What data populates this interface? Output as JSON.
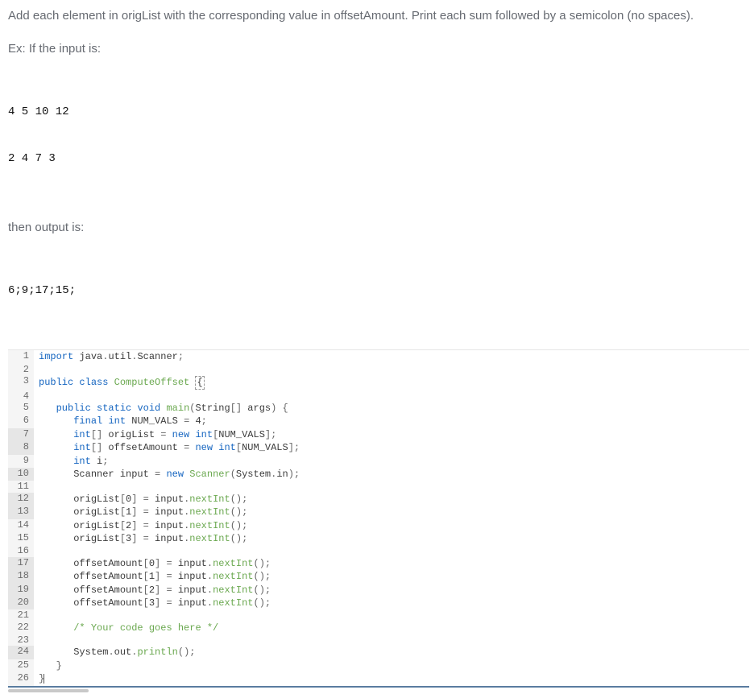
{
  "prompt": {
    "instruction": "Add each element in origList with the corresponding value in offsetAmount. Print each sum followed by a semicolon (no spaces).",
    "ex_label": "Ex: If the input is:",
    "input_lines": [
      "4 5 10 12",
      "2 4 7 3"
    ],
    "then_label": "then output is:",
    "output_line": "6;9;17;15;"
  },
  "code": {
    "lines": [
      {
        "n": 1,
        "indent": 0,
        "tokens": [
          [
            "kw",
            "import"
          ],
          [
            "pl",
            " java"
          ],
          [
            "op",
            "."
          ],
          [
            "pl",
            "util"
          ],
          [
            "op",
            "."
          ],
          [
            "pl",
            "Scanner"
          ],
          [
            "op",
            ";"
          ]
        ]
      },
      {
        "n": 2,
        "indent": 0,
        "tokens": []
      },
      {
        "n": 3,
        "indent": 0,
        "tokens": [
          [
            "kw",
            "public"
          ],
          [
            "pl",
            " "
          ],
          [
            "kw",
            "class"
          ],
          [
            "pl",
            " "
          ],
          [
            "mth",
            "ComputeOffset"
          ],
          [
            "pl",
            " "
          ],
          [
            "bracebox",
            "{"
          ]
        ]
      },
      {
        "n": 4,
        "indent": 0,
        "tokens": []
      },
      {
        "n": 5,
        "indent": 3,
        "tokens": [
          [
            "kw",
            "public"
          ],
          [
            "pl",
            " "
          ],
          [
            "kw",
            "static"
          ],
          [
            "pl",
            " "
          ],
          [
            "kw",
            "void"
          ],
          [
            "pl",
            " "
          ],
          [
            "mth",
            "main"
          ],
          [
            "op",
            "("
          ],
          [
            "pl",
            "String"
          ],
          [
            "op",
            "[]"
          ],
          [
            "pl",
            " args"
          ],
          [
            "op",
            ")"
          ],
          [
            "pl",
            " "
          ],
          [
            "op",
            "{"
          ]
        ]
      },
      {
        "n": 6,
        "indent": 6,
        "tokens": [
          [
            "kw",
            "final"
          ],
          [
            "pl",
            " "
          ],
          [
            "kw",
            "int"
          ],
          [
            "pl",
            " NUM_VALS "
          ],
          [
            "op",
            "="
          ],
          [
            "pl",
            " 4"
          ],
          [
            "op",
            ";"
          ]
        ]
      },
      {
        "n": 7,
        "indent": 6,
        "tokens": [
          [
            "kw",
            "int"
          ],
          [
            "op",
            "[]"
          ],
          [
            "pl",
            " origList "
          ],
          [
            "op",
            "="
          ],
          [
            "pl",
            " "
          ],
          [
            "kw",
            "new"
          ],
          [
            "pl",
            " "
          ],
          [
            "kw",
            "int"
          ],
          [
            "op",
            "["
          ],
          [
            "pl",
            "NUM_VALS"
          ],
          [
            "op",
            "];"
          ]
        ]
      },
      {
        "n": 8,
        "indent": 6,
        "tokens": [
          [
            "kw",
            "int"
          ],
          [
            "op",
            "[]"
          ],
          [
            "pl",
            " offsetAmount "
          ],
          [
            "op",
            "="
          ],
          [
            "pl",
            " "
          ],
          [
            "kw",
            "new"
          ],
          [
            "pl",
            " "
          ],
          [
            "kw",
            "int"
          ],
          [
            "op",
            "["
          ],
          [
            "pl",
            "NUM_VALS"
          ],
          [
            "op",
            "];"
          ]
        ]
      },
      {
        "n": 9,
        "indent": 6,
        "tokens": [
          [
            "kw",
            "int"
          ],
          [
            "pl",
            " i"
          ],
          [
            "op",
            ";"
          ]
        ]
      },
      {
        "n": 10,
        "indent": 6,
        "tokens": [
          [
            "pl",
            "Scanner input "
          ],
          [
            "op",
            "="
          ],
          [
            "pl",
            " "
          ],
          [
            "kw",
            "new"
          ],
          [
            "pl",
            " "
          ],
          [
            "mth",
            "Scanner"
          ],
          [
            "op",
            "("
          ],
          [
            "pl",
            "System"
          ],
          [
            "op",
            "."
          ],
          [
            "pl",
            "in"
          ],
          [
            "op",
            ");"
          ]
        ]
      },
      {
        "n": 11,
        "indent": 0,
        "tokens": []
      },
      {
        "n": 12,
        "indent": 6,
        "tokens": [
          [
            "pl",
            "origList"
          ],
          [
            "op",
            "["
          ],
          [
            "pl",
            "0"
          ],
          [
            "op",
            "]"
          ],
          [
            "pl",
            " "
          ],
          [
            "op",
            "="
          ],
          [
            "pl",
            " input"
          ],
          [
            "op",
            "."
          ],
          [
            "mth",
            "nextInt"
          ],
          [
            "op",
            "();"
          ]
        ]
      },
      {
        "n": 13,
        "indent": 6,
        "tokens": [
          [
            "pl",
            "origList"
          ],
          [
            "op",
            "["
          ],
          [
            "pl",
            "1"
          ],
          [
            "op",
            "]"
          ],
          [
            "pl",
            " "
          ],
          [
            "op",
            "="
          ],
          [
            "pl",
            " input"
          ],
          [
            "op",
            "."
          ],
          [
            "mth",
            "nextInt"
          ],
          [
            "op",
            "();"
          ]
        ]
      },
      {
        "n": 14,
        "indent": 6,
        "tokens": [
          [
            "pl",
            "origList"
          ],
          [
            "op",
            "["
          ],
          [
            "pl",
            "2"
          ],
          [
            "op",
            "]"
          ],
          [
            "pl",
            " "
          ],
          [
            "op",
            "="
          ],
          [
            "pl",
            " input"
          ],
          [
            "op",
            "."
          ],
          [
            "mth",
            "nextInt"
          ],
          [
            "op",
            "();"
          ]
        ]
      },
      {
        "n": 15,
        "indent": 6,
        "tokens": [
          [
            "pl",
            "origList"
          ],
          [
            "op",
            "["
          ],
          [
            "pl",
            "3"
          ],
          [
            "op",
            "]"
          ],
          [
            "pl",
            " "
          ],
          [
            "op",
            "="
          ],
          [
            "pl",
            " input"
          ],
          [
            "op",
            "."
          ],
          [
            "mth",
            "nextInt"
          ],
          [
            "op",
            "();"
          ]
        ]
      },
      {
        "n": 16,
        "indent": 0,
        "tokens": []
      },
      {
        "n": 17,
        "indent": 6,
        "tokens": [
          [
            "pl",
            "offsetAmount"
          ],
          [
            "op",
            "["
          ],
          [
            "pl",
            "0"
          ],
          [
            "op",
            "]"
          ],
          [
            "pl",
            " "
          ],
          [
            "op",
            "="
          ],
          [
            "pl",
            " input"
          ],
          [
            "op",
            "."
          ],
          [
            "mth",
            "nextInt"
          ],
          [
            "op",
            "();"
          ]
        ]
      },
      {
        "n": 18,
        "indent": 6,
        "tokens": [
          [
            "pl",
            "offsetAmount"
          ],
          [
            "op",
            "["
          ],
          [
            "pl",
            "1"
          ],
          [
            "op",
            "]"
          ],
          [
            "pl",
            " "
          ],
          [
            "op",
            "="
          ],
          [
            "pl",
            " input"
          ],
          [
            "op",
            "."
          ],
          [
            "mth",
            "nextInt"
          ],
          [
            "op",
            "();"
          ]
        ]
      },
      {
        "n": 19,
        "indent": 6,
        "tokens": [
          [
            "pl",
            "offsetAmount"
          ],
          [
            "op",
            "["
          ],
          [
            "pl",
            "2"
          ],
          [
            "op",
            "]"
          ],
          [
            "pl",
            " "
          ],
          [
            "op",
            "="
          ],
          [
            "pl",
            " input"
          ],
          [
            "op",
            "."
          ],
          [
            "mth",
            "nextInt"
          ],
          [
            "op",
            "();"
          ]
        ]
      },
      {
        "n": 20,
        "indent": 6,
        "tokens": [
          [
            "pl",
            "offsetAmount"
          ],
          [
            "op",
            "["
          ],
          [
            "pl",
            "3"
          ],
          [
            "op",
            "]"
          ],
          [
            "pl",
            " "
          ],
          [
            "op",
            "="
          ],
          [
            "pl",
            " input"
          ],
          [
            "op",
            "."
          ],
          [
            "mth",
            "nextInt"
          ],
          [
            "op",
            "();"
          ]
        ]
      },
      {
        "n": 21,
        "indent": 0,
        "tokens": []
      },
      {
        "n": 22,
        "indent": 6,
        "tokens": [
          [
            "cmt",
            "/* Your code goes here */"
          ]
        ]
      },
      {
        "n": 23,
        "indent": 0,
        "tokens": []
      },
      {
        "n": 24,
        "indent": 6,
        "tokens": [
          [
            "pl",
            "System"
          ],
          [
            "op",
            "."
          ],
          [
            "pl",
            "out"
          ],
          [
            "op",
            "."
          ],
          [
            "mth",
            "println"
          ],
          [
            "op",
            "();"
          ]
        ]
      },
      {
        "n": 25,
        "indent": 3,
        "tokens": [
          [
            "op",
            "}"
          ]
        ]
      },
      {
        "n": 26,
        "indent": 0,
        "tokens": [
          [
            "op",
            "}"
          ],
          [
            "cursor",
            ""
          ]
        ]
      }
    ],
    "active_lines": [
      7,
      8,
      10,
      12,
      13,
      17,
      18,
      19,
      20,
      24
    ]
  }
}
